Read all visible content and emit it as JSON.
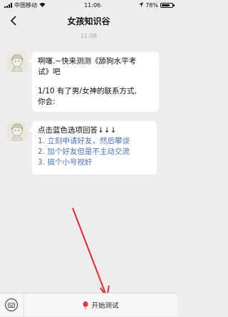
{
  "status_bar": {
    "carrier": "中国移动",
    "time": "11:06",
    "battery_text": "78%",
    "battery_level": 0.78
  },
  "nav": {
    "title": "女孩知识谷"
  },
  "chat": {
    "timestamp": "11:08",
    "message1": {
      "line1": "啊噻.~快来测测《舔狗水平考",
      "line2": "试》吧",
      "line3": "1/10 有了男/女神的联系方式,",
      "line4": "你会:"
    },
    "message2": {
      "prompt": "点击蓝色选项回答↓↓↓",
      "options": [
        "1. 立刻申请好友，然后攀谈",
        "2. 加个好友但是不主动交流",
        "3. 搞个小号视奸"
      ]
    }
  },
  "bottom_bar": {
    "start_label": "开始测试"
  },
  "colors": {
    "option_blue": "#4a73b9",
    "arrow_red": "#e8272a",
    "background": "#ededed"
  }
}
